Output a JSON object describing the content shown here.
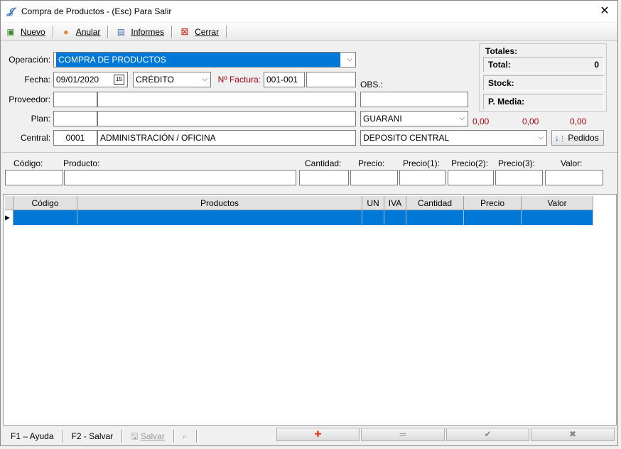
{
  "window": {
    "title": "Compra de Productos  -  (Esc) Para Salir"
  },
  "toolbar": {
    "nuevo": "Nuevo",
    "anular": "Anular",
    "informes": "Informes",
    "cerrar": "Cerrar"
  },
  "form": {
    "operacion_label": "Operación:",
    "operacion_value": "COMPRA DE PRODUCTOS",
    "fecha_label": "Fecha:",
    "fecha_value": "09/01/2020",
    "calendar_glyph": "15",
    "condicion_value": "CRÉDITO",
    "factura_label": "Nº Factura:",
    "factura_value": "001-001",
    "factura_num": "",
    "obs_label": "OBS.:",
    "obs_value": "",
    "proveedor_label": "Proveedor:",
    "proveedor_code": "",
    "proveedor_name": "",
    "plan_label": "Plan:",
    "plan_code": "",
    "plan_name": "",
    "moneda_value": "GUARANI",
    "central_label": "Central:",
    "central_code": "0001",
    "central_name": "ADMINISTRACIÓN / OFICINA",
    "deposito_value": "DEPOSITO CENTRAL",
    "pedidos_label": "Pedidos"
  },
  "totals": {
    "header": "Totales:",
    "total_label": "Total:",
    "total_value": "0",
    "stock_label": "Stock:",
    "pmedia_label": "P. Media:",
    "red_values": [
      "0,00",
      "0,00",
      "0,00"
    ]
  },
  "entry": {
    "codigo": "Código:",
    "producto": "Producto:",
    "cantidad": "Cantidad:",
    "precio": "Precio:",
    "precio1": "Precio(1):",
    "precio2": "Precio(2):",
    "precio3": "Precio(3):",
    "valor": "Valor:"
  },
  "grid": {
    "columns": [
      "Código",
      "Productos",
      "UN",
      "IVA",
      "Cantidad",
      "Precio",
      "Valor"
    ]
  },
  "status": {
    "f1": "F1 – Ayuda",
    "f2": "F2 - Salvar",
    "salvar": "Salvar",
    "nav_add": "✚",
    "nav_minus": "═",
    "nav_check": "✔",
    "nav_cancel": "✖"
  },
  "colors": {
    "selection": "#0078d7",
    "accent_red": "#b0000d"
  }
}
